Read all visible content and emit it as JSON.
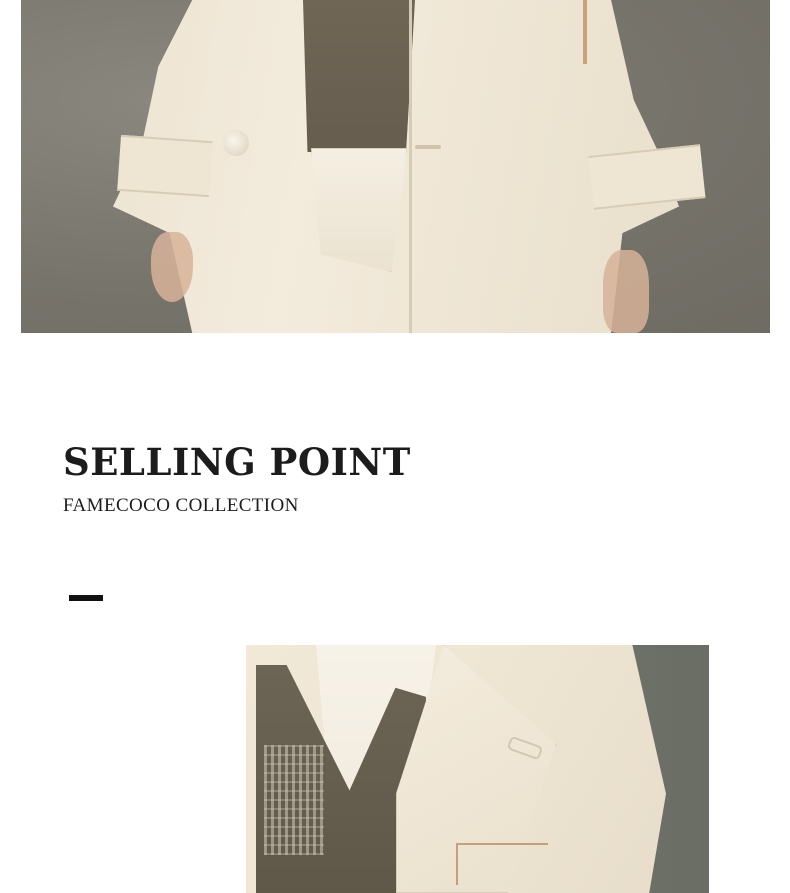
{
  "hero_image": {
    "alt": "Cream trench coat worn over knit vest and shirt, hands at sides"
  },
  "section": {
    "title": "SELLING POINT",
    "subtitle": "FAMECOCO COLLECTION"
  },
  "detail_image": {
    "alt": "Close-up of cream coat lapel over knit vest with printed motif and embroidered detail"
  },
  "colors": {
    "text": "#1c1c1c",
    "accent_bar": "#111111",
    "background": "#ffffff"
  }
}
